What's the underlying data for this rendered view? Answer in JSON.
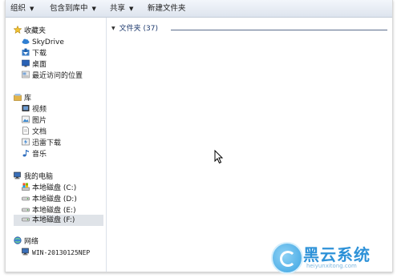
{
  "toolbar": {
    "organize": "组织",
    "include_in_library": "包含到库中",
    "share": "共享",
    "new_folder": "新建文件夹"
  },
  "sidebar": {
    "favorites": {
      "label": "收藏夹",
      "items": [
        "SkyDrive",
        "下载",
        "桌面",
        "最近访问的位置"
      ]
    },
    "libraries": {
      "label": "库",
      "items": [
        "视频",
        "图片",
        "文档",
        "迅雷下载",
        "音乐"
      ]
    },
    "computer": {
      "label": "我的电脑",
      "drives": [
        "本地磁盘 (C:)",
        "本地磁盘 (D:)",
        "本地磁盘 (E:)",
        "本地磁盘 (F:)"
      ],
      "selected": "本地磁盘 (F:)"
    },
    "network": {
      "label": "网络",
      "items": [
        "WIN-20130125NEP"
      ]
    }
  },
  "main": {
    "group_header": "文件夹 (37)"
  },
  "watermark": {
    "text": "黑云系统",
    "url": "heiyunxitong.com"
  },
  "colors": {
    "toolbar_top": "#f3f6fb",
    "toolbar_bottom": "#dde4ee",
    "selection": "#dfe3e8",
    "watermark": "#2e92d8"
  }
}
